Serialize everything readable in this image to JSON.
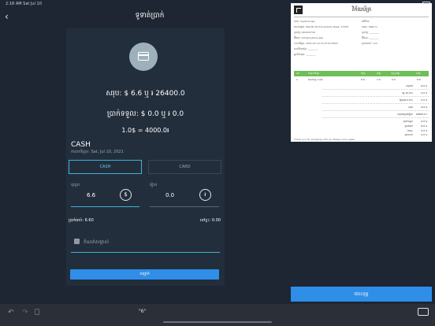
{
  "status_bar": {
    "time_date": "2:18 AM  Sat Jul 10"
  },
  "header": {
    "title": "ទូទាត់ប្រាក់",
    "back_icon": "chevron-left-icon"
  },
  "payment": {
    "total_line": "សរុប: $ 6.6 ឬ ៛ 26400.0",
    "paid_line": "ប្រាក់ទទួល: $ 0.0 ឬ ៛ 0.0",
    "rate_line": "1.0$ = 4000.0៛",
    "method": "CASH",
    "date_line": "កាលបរិច្ឆេទ: Sat, Jul 10, 2021",
    "tabs": [
      {
        "label": "CASH",
        "selected": true
      },
      {
        "label": "CARD",
        "selected": false
      }
    ],
    "usd_field": {
      "label": "ដុល្លារ",
      "value": "6.6",
      "currency": "$"
    },
    "riel_field": {
      "label": "រៀល",
      "value": "0.0",
      "currency": "៛"
    },
    "change_line": "ប្រាក់អាប់: 6.60",
    "remain_line": "នៅខ្វះ: 0.00",
    "note_placeholder": "កំណត់សម្គាល់",
    "confirm_label": "បញ្ជាក់"
  },
  "receipt": {
    "title": "វិក័យប័ត្រ",
    "info_left": [
      "ហាង: mystore.app",
      "អាសយដ្ឋាន: Wat Bo Rd Krong Siem Reap, 17259",
      "ទូរស័ព្ទ: 010424744",
      "អ៊ីមែល: info@mystore.app",
      "កាលបរិច្ឆេទ: 2021-07-10 11:47:01.6022",
      "លេខវិក័យប័ត្រ: ________",
      "អ្នកគិតលុយ: ________"
    ],
    "info_right": [
      "អតិថិជន",
      "ឈ្មោះ: Walk-in",
      "ទូរស័ព្ទ: ________",
      "អ៊ីមែល: ________",
      "ប្រភេទលក់: null"
    ],
    "table_headers": [
      "លរ",
      "ឈ្មោះទំនិញ",
      "ចំនួន",
      "តម្លៃ",
      "បញ្ចុះតម្លៃ",
      "សរុប"
    ],
    "rows": [
      [
        "1",
        "testing code",
        "6.6",
        "1.0",
        "0.0",
        "6.6"
      ]
    ],
    "summary": [
      {
        "label": "សរុបរង",
        "value": "6.6 $"
      },
      {
        "label": "ពន្ធ 10.0%",
        "value": "0.0 $"
      },
      {
        "label": "ថ្លៃសេវា 0.0%",
        "value": "0.0 $"
      },
      {
        "label": "សរុប",
        "value": "6.6 $"
      },
      {
        "label": "សរុបជាប្រាក់រៀល",
        "value": "26400.0 ៛"
      },
      {
        "label": "ប្រាក់ទទួល",
        "value": "0.0 $"
      },
      {
        "label": "ប្រាក់អាប់",
        "value": "6.6 $"
      },
      {
        "label": "នៅខ្វះ",
        "value": "0.0 $"
      },
      {
        "label": "ស្ថានភាព",
        "value": "0.0 $"
      }
    ],
    "thanks": "Thank you for shopping with us. Please come again"
  },
  "print_label": "បោះពុម្ព",
  "keyboard": {
    "suggestion": "\"6\""
  }
}
